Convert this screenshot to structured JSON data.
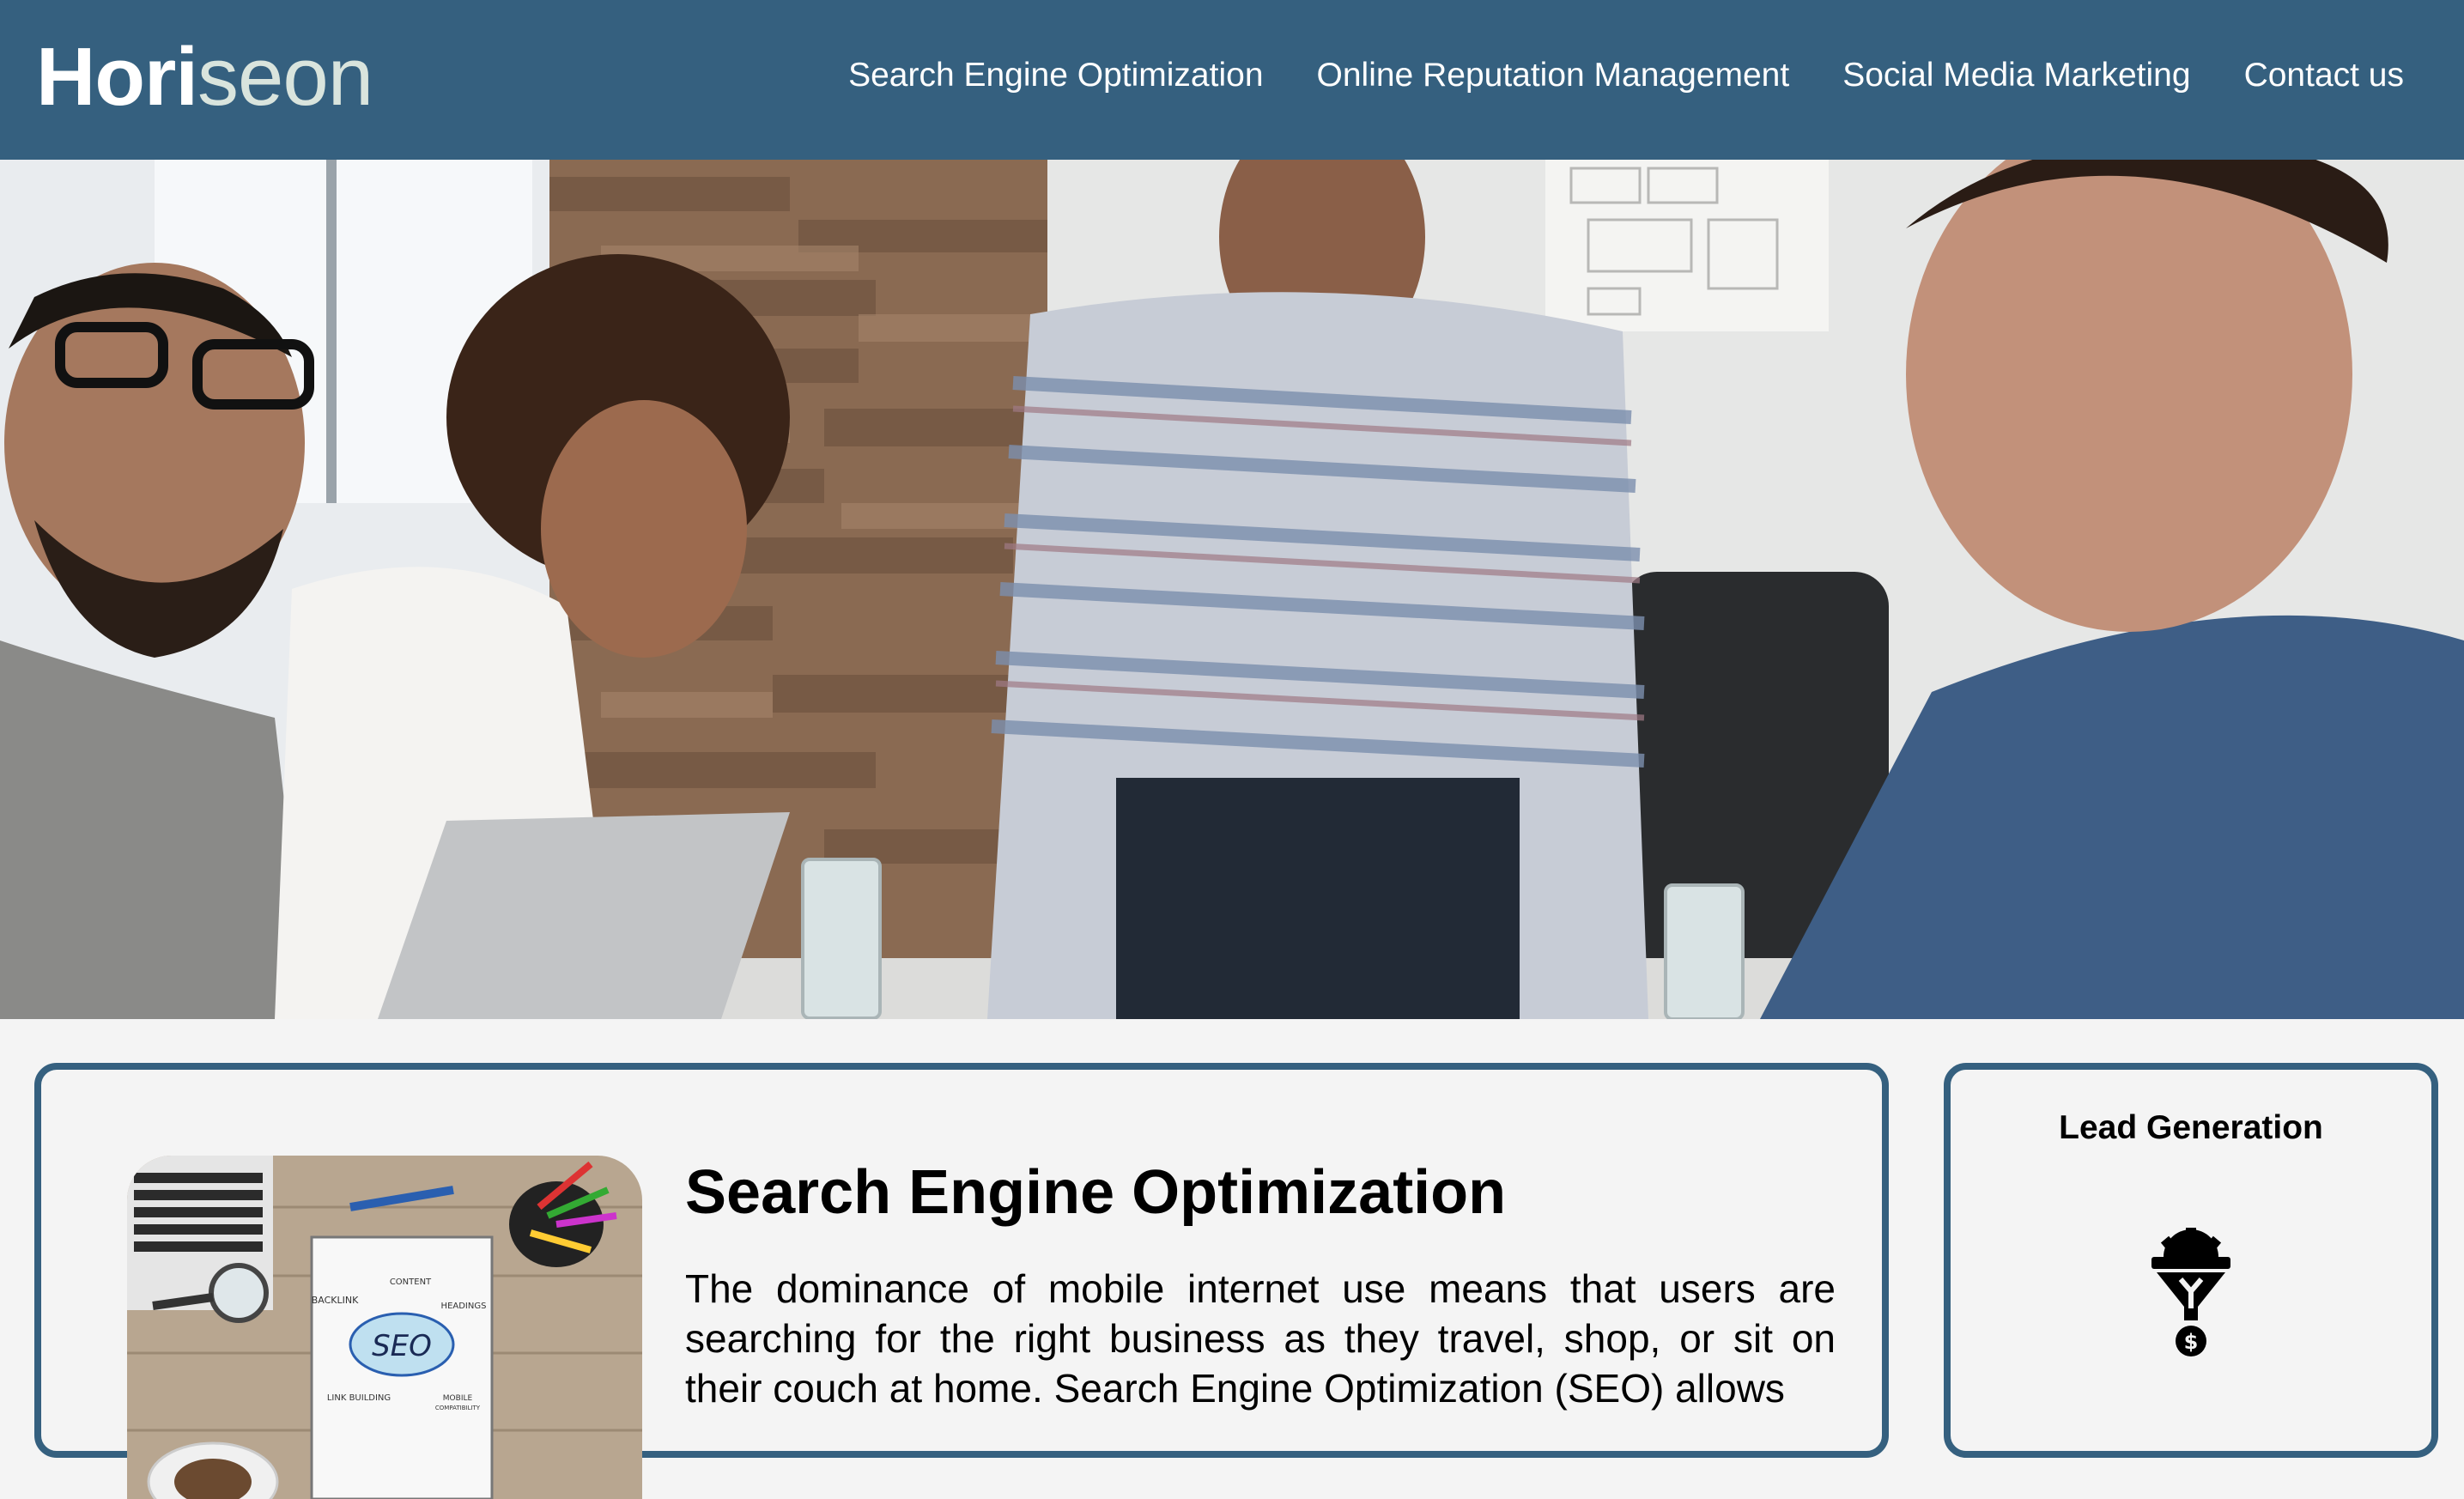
{
  "header": {
    "logo_main": "Hori",
    "logo_accent": "seon",
    "nav": [
      {
        "label": "Search Engine Optimization"
      },
      {
        "label": "Online Reputation Management"
      },
      {
        "label": "Social Media Marketing"
      },
      {
        "label": "Contact us"
      }
    ]
  },
  "hero": {
    "icon": "team-meeting-photo"
  },
  "main": {
    "title": "Search Engine Optimization",
    "body": "The dominance of mobile internet use means that users are searching for the right business as they travel, shop, or sit on their couch at home. Search Engine Optimization (SEO) allows",
    "image_icon": "seo-desk-photo",
    "image_labels": {
      "seo": "SEO",
      "content": "CONTENT",
      "backlink": "BACKLINK",
      "headings": "HEADINGS",
      "link_building": "LINK BUILDING",
      "mobile": "MOBILE",
      "compatibility": "COMPATIBILITY"
    }
  },
  "sidebar": {
    "title": "Lead Generation",
    "icon": "lead-generation-funnel-icon"
  },
  "colors": {
    "brand": "#35607f",
    "background": "#f4f4f4",
    "text": "#000000",
    "logo_accent": "#d9e4dd"
  }
}
